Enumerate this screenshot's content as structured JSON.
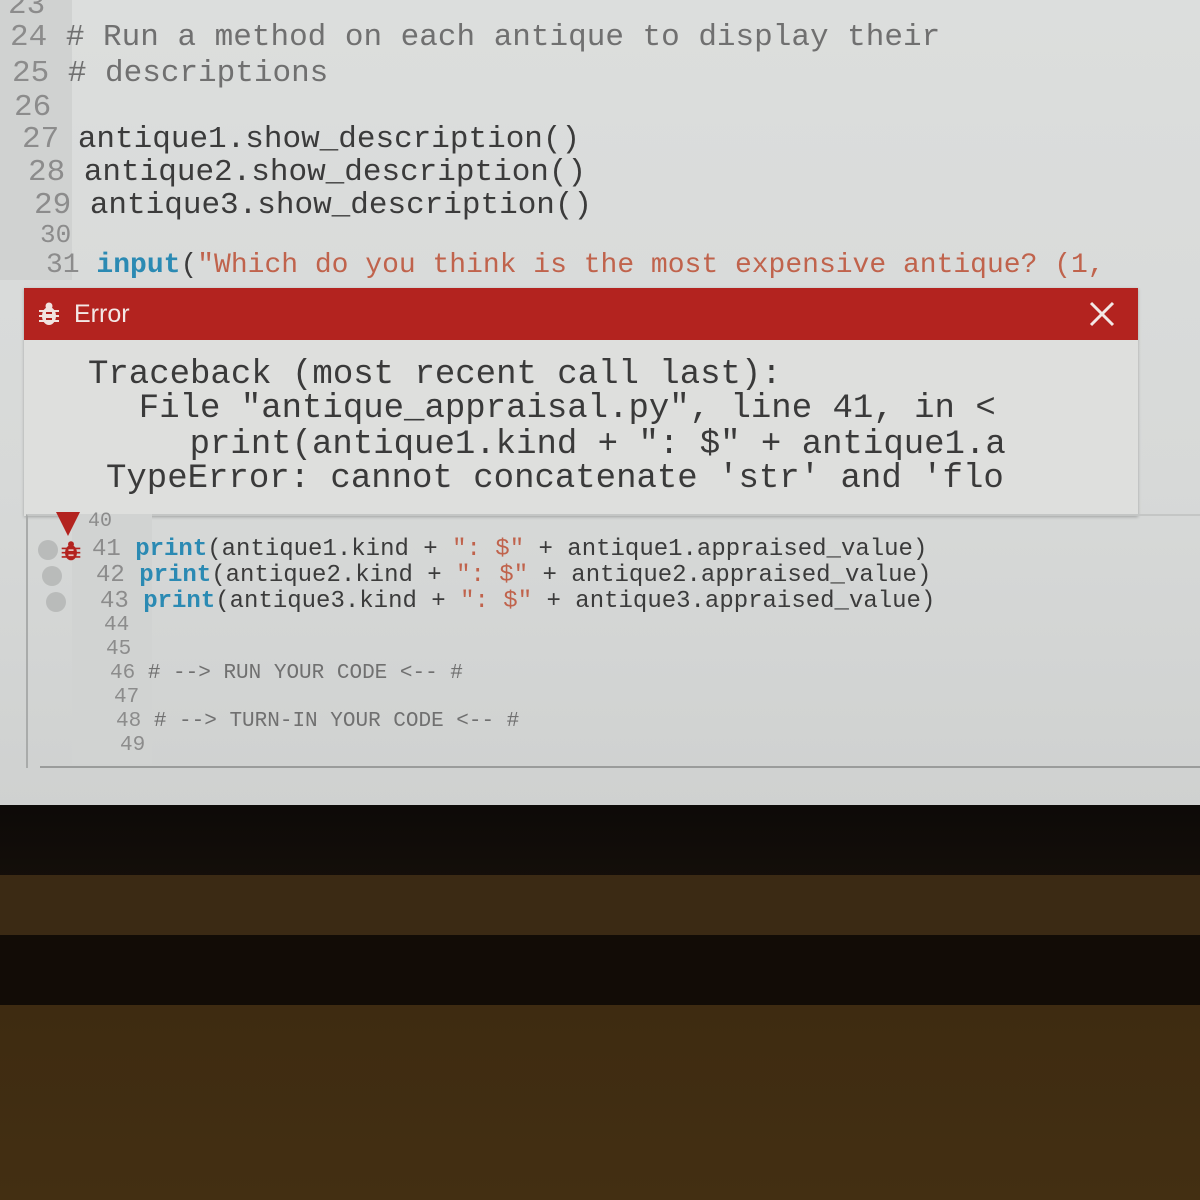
{
  "editor": {
    "top_lines": [
      {
        "num": "23",
        "code": ""
      },
      {
        "num": "24",
        "code": "# Run a method on each antique to display their"
      },
      {
        "num": "25",
        "code": "# descriptions"
      },
      {
        "num": "26",
        "code": ""
      },
      {
        "num": "27",
        "code": "antique1.show_description()"
      },
      {
        "num": "28",
        "code": "antique2.show_description()"
      },
      {
        "num": "29",
        "code": "antique3.show_description()"
      },
      {
        "num": "30",
        "code": ""
      }
    ],
    "line31": {
      "num": "31",
      "keyword": "input",
      "paren": "(",
      "string": "\"Which do you think is the most expensive antique? (1,"
    },
    "lower_lines": [
      {
        "num": "40"
      },
      {
        "num": "41",
        "keyword": "print",
        "pre": "(antique1.kind + ",
        "string": "\": $\"",
        "post": " + antique1.appraised_value)"
      },
      {
        "num": "42",
        "keyword": "print",
        "pre": "(antique2.kind + ",
        "string": "\": $\"",
        "post": " + antique2.appraised_value)"
      },
      {
        "num": "43",
        "keyword": "print",
        "pre": "(antique3.kind + ",
        "string": "\": $\"",
        "post": " + antique3.appraised_value)"
      },
      {
        "num": "44"
      },
      {
        "num": "45"
      },
      {
        "num": "46",
        "comment": "# --> RUN YOUR CODE <-- #"
      },
      {
        "num": "47"
      },
      {
        "num": "48",
        "comment": "# --> TURN-IN YOUR CODE <-- #"
      },
      {
        "num": "49"
      }
    ],
    "error_line": "41"
  },
  "error_dialog": {
    "title": "Error",
    "icon": "bug-icon",
    "close_icon": "close-icon",
    "traceback": [
      "Traceback (most recent call last):",
      "  File \"antique_appraisal.py\", line 41, in <",
      "    print(antique1.kind + \": $\" + antique1.a",
      "TypeError: cannot concatenate 'str' and 'flo"
    ]
  },
  "colors": {
    "error_red": "#b3231f",
    "keyword_blue": "#2b8ab3",
    "string_red": "#c0634c"
  }
}
